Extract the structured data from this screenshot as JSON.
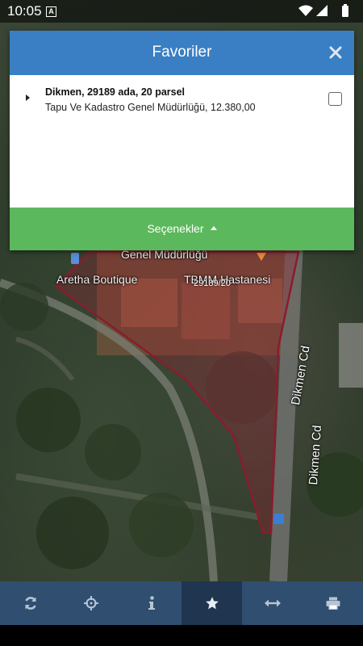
{
  "status_bar": {
    "time": "10:05",
    "notification_icon": "A"
  },
  "dialog": {
    "title": "Favoriler",
    "close_icon": "close-icon",
    "items": [
      {
        "title": "Dikmen, 29189 ada, 20 parsel",
        "subtitle": "Tapu Ve Kadastro Genel Müdürlüğü, 12.380,00",
        "checked": false
      }
    ],
    "options_label": "Seçenekler"
  },
  "map": {
    "labels": {
      "place_1": "Genel Müdürlüğü",
      "place_2": "Aretha Boutique",
      "place_3": "TBMM Hastanesi",
      "parcel": "29189/20",
      "street_1": "Dikmen Cd",
      "street_2": "Dikmen Cd"
    }
  },
  "toolbar": {
    "items": [
      {
        "name": "refresh-icon",
        "active": false
      },
      {
        "name": "locate-icon",
        "active": false
      },
      {
        "name": "info-icon",
        "active": false
      },
      {
        "name": "star-icon",
        "active": true
      },
      {
        "name": "measure-icon",
        "active": false
      },
      {
        "name": "print-icon",
        "active": false
      }
    ]
  },
  "colors": {
    "header_blue": "#3a7fc3",
    "options_green": "#5cb85c",
    "toolbar_bg": "#2f4e70",
    "toolbar_active": "#1f3550",
    "parcel_stroke": "#8a1c2c"
  }
}
